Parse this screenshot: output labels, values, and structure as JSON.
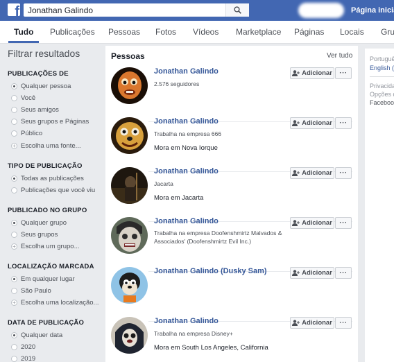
{
  "header": {
    "logo": "f",
    "search_value": "Jonathan Galindo",
    "home_label": "Página inicial"
  },
  "tabs": [
    {
      "label": "Tudo",
      "active": true
    },
    {
      "label": "Publicações"
    },
    {
      "label": "Pessoas"
    },
    {
      "label": "Fotos"
    },
    {
      "label": "Vídeos"
    },
    {
      "label": "Marketplace"
    },
    {
      "label": "Páginas"
    },
    {
      "label": "Locais"
    },
    {
      "label": "Grupos"
    }
  ],
  "filters": {
    "title": "Filtrar resultados",
    "sections": [
      {
        "heading": "PUBLICAÇÕES DE",
        "options": [
          "Qualquer pessoa",
          "Você",
          "Seus amigos",
          "Seus grupos e Páginas",
          "Público",
          "Escolha uma fonte..."
        ]
      },
      {
        "heading": "TIPO DE PUBLICAÇÃO",
        "options": [
          "Todas as publicações",
          "Publicações que você viu"
        ]
      },
      {
        "heading": "PUBLICADO NO GRUPO",
        "options": [
          "Qualquer grupo",
          "Seus grupos",
          "Escolha um grupo..."
        ]
      },
      {
        "heading": "LOCALIZAÇÃO MARCADA",
        "options": [
          "Em qualquer lugar",
          "São Paulo",
          "Escolha uma localização..."
        ]
      },
      {
        "heading": "DATA DE PUBLICAÇÃO",
        "options": [
          "Qualquer data",
          "2020",
          "2019"
        ]
      }
    ]
  },
  "results": {
    "title": "Pessoas",
    "see_all": "Ver tudo",
    "add_label": "Adicionar",
    "more_label": "···",
    "people": [
      {
        "name": "Jonathan Galindo",
        "sub": "2.576 seguidores",
        "loc": ""
      },
      {
        "name": "Jonathan Galindo",
        "sub": "Trabalha na empresa 666",
        "loc": "Mora em Nova Iorque"
      },
      {
        "name": "Jonathan Galindo",
        "sub": "Jacarta",
        "loc": "Mora em Jacarta"
      },
      {
        "name": "Jonathan Galindo",
        "sub": "Trabalha na empresa Doofenshmirtz Malvados & Associados' (Doofenshmirtz Evil Inc.)",
        "loc": ""
      },
      {
        "name": "Jonathan Galindo (Dusky Sam)",
        "sub": "",
        "loc": ""
      },
      {
        "name": "Jonathan Galindo",
        "sub": "Trabalha na empresa Disney+",
        "loc": "Mora em South Los Angeles, California"
      }
    ]
  },
  "right": {
    "lang_1": "Português",
    "lang_2": "English (US)",
    "footer_1": "Privacidade",
    "footer_2": "Opções de anúncios",
    "footer_3": "Facebook"
  }
}
